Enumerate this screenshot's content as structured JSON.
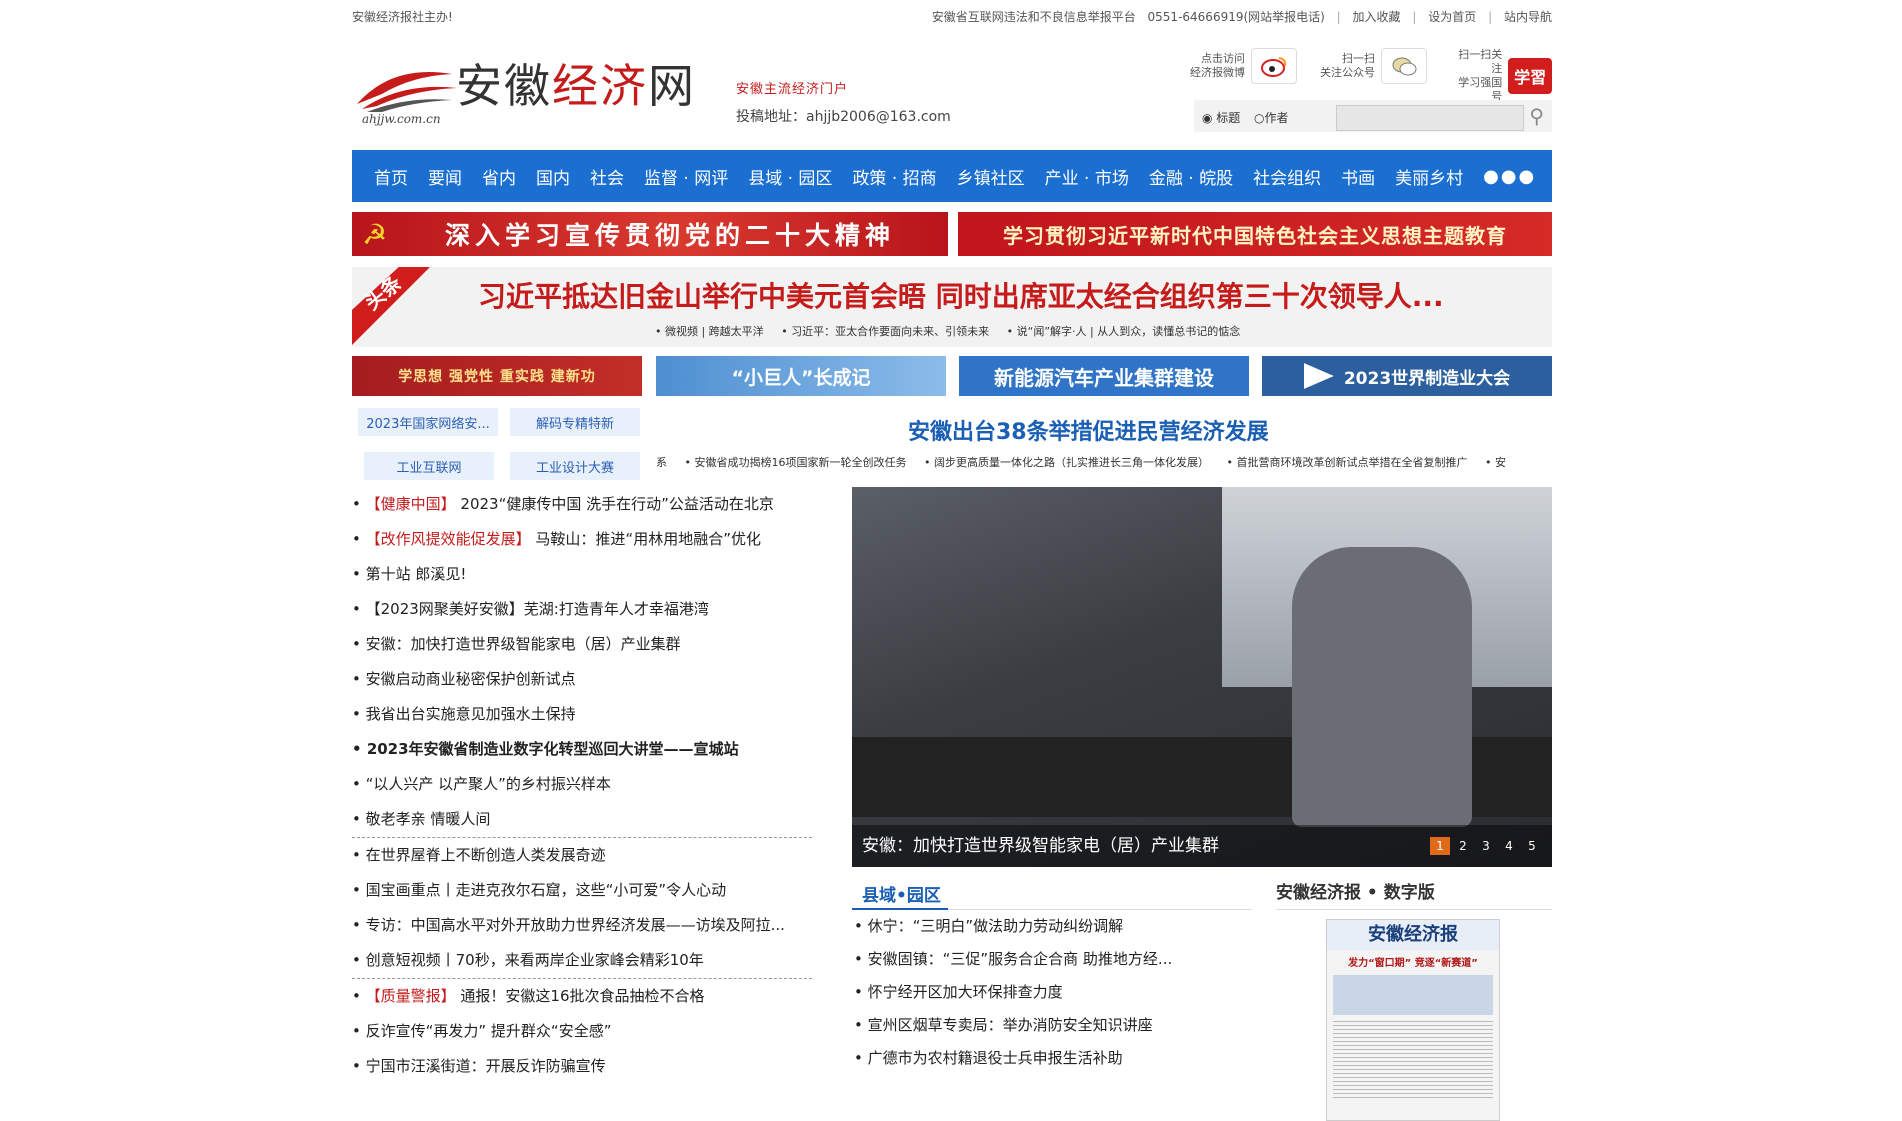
{
  "topbar": {
    "sponsor": "安徽经济报社主办!",
    "report": "安徽省互联网违法和不良信息举报平台",
    "phone": "0551-64666919(网站举报电话)",
    "favorite": "加入收藏",
    "homepage": "设为首页",
    "sitemap": "站内导航"
  },
  "header": {
    "logo_domain": "ahjjw.com.cn",
    "logo_name_a": "安徽",
    "logo_name_b": "经济",
    "logo_name_c": "网",
    "tagline": "安徽主流经济门户",
    "contribute": "投稿地址：ahjjb2006@163.com",
    "weibo_text_1": "点击访问",
    "weibo_text_2": "经济报微博",
    "wechat_text_1": "扫一扫",
    "wechat_text_2": "关注公众号",
    "xuexi_text_1": "扫一扫关注",
    "xuexi_text_2": "学习强国号",
    "xuexi_logo": "学習",
    "search_opt_title": "标题",
    "search_opt_author": "作者"
  },
  "nav": {
    "items": [
      "首页",
      "要闻",
      "省内",
      "国内",
      "社会",
      "监督 · 网评",
      "县域 · 园区",
      "政策 · 招商",
      "乡镇社区",
      "产业 · 市场",
      "金融 · 皖股",
      "社会组织",
      "书画",
      "美丽乡村"
    ],
    "more": "●●●"
  },
  "banners": {
    "b1": "深入学习宣传贯彻党的二十大精神",
    "b2": "学习贯彻习近平新时代中国特色社会主义思想主题教育"
  },
  "headline": {
    "tag": "头条",
    "title": "习近平抵达旧金山举行中美元首会晤 同时出席亚太经合组织第三十次领导人...",
    "subs": [
      "• 微视频 | 跨越太平洋",
      "• 习近平：亚太合作要面向未来、引领未来",
      "• 说“闻”解字·人 | 从人到众，读懂总书记的惦念"
    ]
  },
  "promos": {
    "p1": "学思想  强党性  重实践  建新功",
    "p2": "“小巨人”长成记",
    "p3": "新能源汽车产业集群建设",
    "p4": "2023世界制造业大会"
  },
  "tags": [
    "2023年国家网络安...",
    "解码专精特新",
    "工业互联网",
    "工业设计大赛"
  ],
  "center": {
    "title": "安徽出台38条举措促进民营经济发展",
    "ticker": [
      "系",
      "• 安徽省成功揭榜16项国家新一轮全创改任务",
      "• 阔步更高质量一体化之路（扎实推进长三角一体化发展）",
      "• 首批营商环境改革创新试点举措在全省复制推广",
      "• 安"
    ]
  },
  "news": [
    {
      "cat": "【健康中国】",
      "text": "2023“健康传中国 洗手在行动”公益活动在北京"
    },
    {
      "cat": "【改作风提效能促发展】",
      "text": "马鞍山：推进“用林用地融合”优化"
    },
    {
      "cat": "",
      "text": "第十站 郎溪见!"
    },
    {
      "cat": "",
      "text": "【2023网聚美好安徽】芜湖:打造青年人才幸福港湾"
    },
    {
      "cat": "",
      "text": "安徽：加快打造世界级智能家电（居）产业集群"
    },
    {
      "cat": "",
      "text": "安徽启动商业秘密保护创新试点"
    },
    {
      "cat": "",
      "text": "我省出台实施意见加强水土保持"
    },
    {
      "cat": "",
      "text": "2023年安徽省制造业数字化转型巡回大讲堂——宣城站"
    },
    {
      "cat": "",
      "text": "“以人兴产 以产聚人”的乡村振兴样本"
    },
    {
      "cat": "",
      "text": "敬老孝亲 情暖人间"
    },
    {
      "cat": "",
      "text": "在世界屋脊上不断创造人类发展奇迹"
    },
    {
      "cat": "",
      "text": "国宝画重点丨走进克孜尔石窟，这些“小可爱”令人心动"
    },
    {
      "cat": "",
      "text": "专访：中国高水平对外开放助力世界经济发展——访埃及阿拉..."
    },
    {
      "cat": "",
      "text": "创意短视频丨70秒，来看两岸企业家峰会精彩10年"
    },
    {
      "cat": "【质量警报】",
      "text": "通报！安徽这16批次食品抽检不合格"
    },
    {
      "cat": "",
      "text": "反诈宣传“再发力” 提升群众“安全感”"
    },
    {
      "cat": "",
      "text": "宁国市汪溪街道：开展反诈防骗宣传"
    }
  ],
  "photo": {
    "caption": "安徽：加快打造世界级智能家电（居）产业集群",
    "pages": [
      "1",
      "2",
      "3",
      "4",
      "5"
    ]
  },
  "county": {
    "title": "县域•园区",
    "items": [
      "休宁：“三明白”做法助力劳动纠纷调解",
      "安徽固镇：“三促”服务合企合商 助推地方经...",
      "怀宁经开区加大环保排查力度",
      "宣州区烟草专卖局：举办消防安全知识讲座",
      "广德市为农村籍退役士兵申报生活补助"
    ]
  },
  "epaper": {
    "title": "安徽经济报 • 数字版",
    "masthead": "安徽经济报",
    "headline": "发力“窗口期” 竞逐“新赛道”"
  }
}
